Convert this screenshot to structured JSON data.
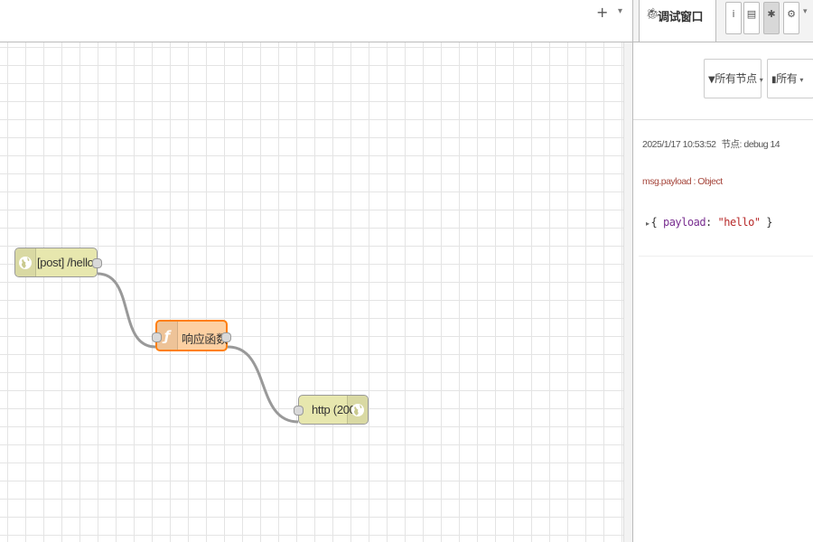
{
  "workspace": {
    "add_icon": "+",
    "menu_icon": "▾"
  },
  "nodes": {
    "http_in": {
      "label": "[post] /hello",
      "icon": "globe-icon"
    },
    "function": {
      "label": "响应函数",
      "icon": "function-icon"
    },
    "http_response": {
      "label": "http (200)",
      "icon": "globe-icon"
    }
  },
  "sidebar": {
    "tab_title": "调试窗口",
    "tab_buttons": [
      {
        "name": "info",
        "glyph": "i"
      },
      {
        "name": "help",
        "glyph": "📄"
      },
      {
        "name": "debug",
        "glyph": "🐞"
      },
      {
        "name": "config",
        "glyph": "⚙"
      }
    ],
    "filter_label": "所有节点",
    "clear_label": "所有"
  },
  "debug_message": {
    "timestamp": "2025/1/17 10:53:52",
    "node": "节点: debug 14",
    "topic": "msg.payload : Object",
    "key": "payload",
    "value": "\"hello\""
  },
  "colors": {
    "http_node": "#e7e7ae",
    "function_node": "#fdd0a2",
    "selected_border": "#ff7f0e",
    "wire": "#999999"
  }
}
